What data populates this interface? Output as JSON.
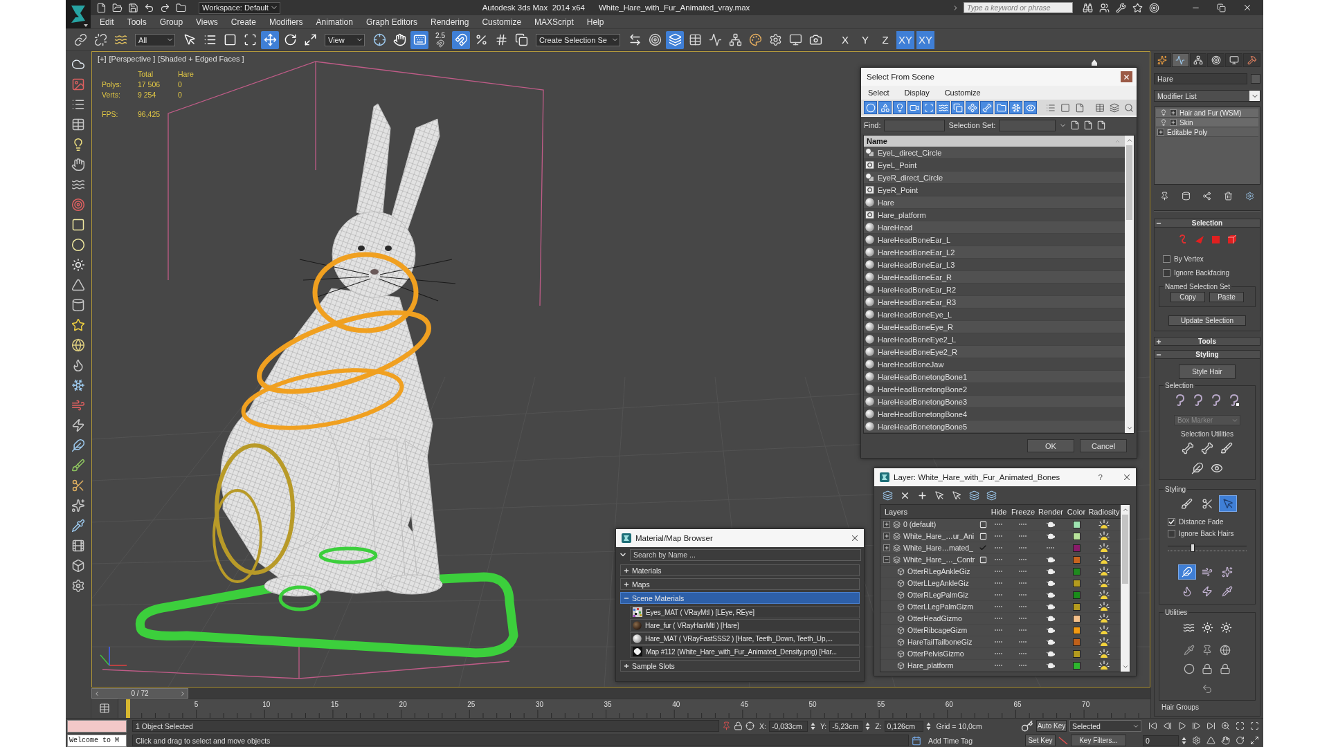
{
  "window": {
    "app_title": "Autodesk 3ds Max  2014 x64",
    "file_title": "White_Hare_with_Fur_Animated_vray.max",
    "workspace": "Workspace: Default",
    "search": {
      "placeholder": "Type a keyword or phrase"
    }
  },
  "menu": [
    "Edit",
    "Tools",
    "Group",
    "Views",
    "Create",
    "Modifiers",
    "Animation",
    "Graph Editors",
    "Rendering",
    "Customize",
    "MAXScript",
    "Help"
  ],
  "toolbar": {
    "items": [
      {
        "kind": "button",
        "selected": false
      },
      {
        "kind": "button",
        "selected": false
      },
      {
        "kind": "button",
        "selected": false
      },
      {
        "kind": "dropdown",
        "value": "All"
      },
      {
        "kind": "button",
        "selected": false
      },
      {
        "kind": "button",
        "selected": false
      },
      {
        "kind": "button",
        "selected": false
      },
      {
        "kind": "button",
        "selected": false
      },
      {
        "kind": "button",
        "selected": true
      },
      {
        "kind": "button",
        "selected": false
      },
      {
        "kind": "button",
        "selected": false
      },
      {
        "kind": "dropdown",
        "value": "View"
      },
      {
        "kind": "button",
        "selected": false
      },
      {
        "kind": "button",
        "selected": false
      },
      {
        "kind": "button",
        "selected": true
      },
      {
        "kind": "snap",
        "label": "2.5",
        "selected": false
      },
      {
        "kind": "button",
        "selected": true
      },
      {
        "kind": "button",
        "selected": false
      },
      {
        "kind": "button",
        "selected": false
      },
      {
        "kind": "button",
        "selected": false
      },
      {
        "kind": "dropdown",
        "value": "Create Selection Se"
      },
      {
        "kind": "button",
        "selected": false
      },
      {
        "kind": "button",
        "selected": false
      },
      {
        "kind": "button",
        "selected": true
      },
      {
        "kind": "button",
        "selected": false
      },
      {
        "kind": "button",
        "selected": false
      },
      {
        "kind": "button",
        "selected": false
      },
      {
        "kind": "button",
        "selected": false
      },
      {
        "kind": "button",
        "selected": false
      },
      {
        "kind": "button",
        "selected": false
      },
      {
        "kind": "button",
        "selected": false
      },
      {
        "kind": "axis",
        "label": "X",
        "selected": false
      },
      {
        "kind": "axis",
        "label": "Y",
        "selected": false
      },
      {
        "kind": "axis",
        "label": "Z",
        "selected": false
      },
      {
        "kind": "axis",
        "label": "XY",
        "selected": true
      },
      {
        "kind": "axis",
        "label": "XY",
        "selected": true
      }
    ]
  },
  "viewport": {
    "labels": [
      "[+]",
      "[Perspective ]",
      "[Shaded + Edged Faces ]"
    ],
    "stats": {
      "headers": [
        "Total",
        "Hare"
      ],
      "rows": [
        {
          "label": "Polys:",
          "values": [
            "17 506",
            "0"
          ]
        },
        {
          "label": "Verts:",
          "values": [
            "9 254",
            "0"
          ]
        }
      ],
      "fps_label": "FPS:",
      "fps": "96,425"
    }
  },
  "select_dialog": {
    "title": "Select From Scene",
    "menu": [
      "Select",
      "Display",
      "Customize"
    ],
    "filters": [
      {
        "selected": true
      },
      {
        "selected": true
      },
      {
        "selected": true
      },
      {
        "selected": true
      },
      {
        "selected": true
      },
      {
        "selected": true
      },
      {
        "selected": true
      },
      {
        "selected": true
      },
      {
        "selected": true
      },
      {
        "selected": true
      },
      {
        "selected": true
      },
      {
        "selected": true
      },
      {
        "selected": false
      },
      {
        "selected": false
      },
      {
        "selected": false
      },
      {
        "selected": false
      },
      {
        "selected": false
      },
      {
        "selected": false
      }
    ],
    "find_label": "Find:",
    "selection_set_label": "Selection Set:",
    "column": "Name",
    "rows": [
      {
        "name": "EyeL_direct_Circle",
        "kind": "shape"
      },
      {
        "name": "EyeL_Point",
        "kind": "helper"
      },
      {
        "name": "EyeR_direct_Circle",
        "kind": "shape"
      },
      {
        "name": "EyeR_Point",
        "kind": "helper"
      },
      {
        "name": "Hare",
        "kind": "geometry"
      },
      {
        "name": "Hare_platform",
        "kind": "helper"
      },
      {
        "name": "HareHead",
        "kind": "geometry"
      },
      {
        "name": "HareHeadBoneEar_L",
        "kind": "geometry"
      },
      {
        "name": "HareHeadBoneEar_L2",
        "kind": "geometry"
      },
      {
        "name": "HareHeadBoneEar_L3",
        "kind": "geometry"
      },
      {
        "name": "HareHeadBoneEar_R",
        "kind": "geometry"
      },
      {
        "name": "HareHeadBoneEar_R2",
        "kind": "geometry"
      },
      {
        "name": "HareHeadBoneEar_R3",
        "kind": "geometry"
      },
      {
        "name": "HareHeadBoneEye_L",
        "kind": "geometry"
      },
      {
        "name": "HareHeadBoneEye_R",
        "kind": "geometry"
      },
      {
        "name": "HareHeadBoneEye2_L",
        "kind": "geometry"
      },
      {
        "name": "HareHeadBoneEye2_R",
        "kind": "geometry"
      },
      {
        "name": "HareHeadBoneJaw",
        "kind": "geometry"
      },
      {
        "name": "HareHeadBonetongBone1",
        "kind": "geometry"
      },
      {
        "name": "HareHeadBonetongBone2",
        "kind": "geometry"
      },
      {
        "name": "HareHeadBonetongBone3",
        "kind": "geometry"
      },
      {
        "name": "HareHeadBonetongBone4",
        "kind": "geometry"
      },
      {
        "name": "HareHeadBonetongBone5",
        "kind": "geometry"
      }
    ],
    "buttons": [
      "OK",
      "Cancel"
    ]
  },
  "layer_dialog": {
    "title": "Layer: White_Hare_with_Fur_Animated_Bones",
    "help": "?",
    "columns": [
      "Layers",
      "Hide",
      "Freeze",
      "Render",
      "Color",
      "Radiosity"
    ],
    "layers": [
      {
        "name": "0 (default)",
        "expanded": false,
        "current": false,
        "hidden": false,
        "frozen": false,
        "render": true,
        "color": "#9ee3b0"
      },
      {
        "name": "White_Hare_…ur_Ani",
        "expanded": false,
        "current": false,
        "hidden": false,
        "frozen": false,
        "render": true,
        "color": "#b7e39a"
      },
      {
        "name": "White_Hare…mated_",
        "expanded": false,
        "current": true,
        "hidden": false,
        "frozen": false,
        "render": false,
        "color": "#8a1a6a"
      },
      {
        "name": "White_Hare_…_Contr",
        "expanded": true,
        "current": false,
        "hidden": false,
        "frozen": false,
        "render": true,
        "color": "#c8641e",
        "children": [
          {
            "name": "OtterRLegAnkleGiz",
            "hidden": false,
            "frozen": false,
            "render": true,
            "color": "#1f8a1f"
          },
          {
            "name": "OtterLLegAnkleGiz",
            "hidden": false,
            "frozen": false,
            "render": true,
            "color": "#b49b1e"
          },
          {
            "name": "OtterRLegPalmGiz",
            "hidden": false,
            "frozen": false,
            "render": true,
            "color": "#1a8c1a"
          },
          {
            "name": "OtterLLegPalmGizm",
            "hidden": false,
            "frozen": false,
            "render": true,
            "color": "#b49b1e"
          },
          {
            "name": "OtterHeadGizmo",
            "hidden": false,
            "frozen": false,
            "render": true,
            "color": "#f5c08a"
          },
          {
            "name": "OtterRibcageGizm",
            "hidden": false,
            "frozen": false,
            "render": true,
            "color": "#f29a12"
          },
          {
            "name": "HareTailTailboneGiz",
            "hidden": false,
            "frozen": false,
            "render": true,
            "color": "#c0601a"
          },
          {
            "name": "OtterPelvisGizmo",
            "hidden": false,
            "frozen": false,
            "render": true,
            "color": "#b49b1e"
          },
          {
            "name": "Hare_platform",
            "hidden": false,
            "frozen": false,
            "render": true,
            "color": "#2eb82e"
          }
        ]
      }
    ]
  },
  "material_browser": {
    "title": "Material/Map Browser",
    "search": {
      "placeholder": "Search by Name ..."
    },
    "groups": [
      {
        "label": "Materials",
        "expanded": false
      },
      {
        "label": "Maps",
        "expanded": false
      },
      {
        "label": "Scene Materials",
        "expanded": true,
        "items": [
          {
            "name": "Eyes_MAT ( VRayMtl ) [LEye, REye]",
            "kind": "noise"
          },
          {
            "name": "Hare_fur ( VRayHairMtl ) [Hare]",
            "kind": "dark"
          },
          {
            "name": "Hare_MAT ( VRayFastSSS2 ) [Hare, Teeth_Down, Teeth_Up,...",
            "kind": "light"
          },
          {
            "name": "Map #112 (White_Hare_with_Fur_Animated_Density.png) [Har...",
            "kind": "map"
          }
        ]
      },
      {
        "label": "Sample Slots",
        "expanded": false
      }
    ]
  },
  "command_panel": {
    "tabs": [
      {
        "selected": false
      },
      {
        "selected": true
      },
      {
        "selected": false
      },
      {
        "selected": false
      },
      {
        "selected": false
      },
      {
        "selected": false
      }
    ],
    "object_name": "Hare",
    "modifier_list": "Modifier List",
    "stack": [
      {
        "name": "Hair and Fur (WSM)",
        "kind": "modifier"
      },
      {
        "name": "Skin",
        "kind": "modifier"
      },
      {
        "name": "Editable Poly",
        "kind": "base"
      }
    ],
    "selection": {
      "title": "Selection",
      "expanded": true,
      "options": [
        {
          "label": "By Vertex",
          "checked": false
        },
        {
          "label": "Ignore Backfacing",
          "checked": false
        }
      ],
      "named_set": {
        "title": "Named Selection Set",
        "buttons": [
          "Copy",
          "Paste"
        ]
      },
      "update": "Update Selection"
    },
    "tools": {
      "title": "Tools",
      "expanded": false
    },
    "styling": {
      "title": "Styling",
      "expanded": true,
      "style_button": "Style Hair",
      "selection_group": {
        "title": "Selection",
        "marker": {
          "value": "Box Marker",
          "disabled": true
        },
        "utilities": "Selection Utilities"
      },
      "styling_group": {
        "title": "Styling",
        "tools": [
          {
            "selected": false
          },
          {
            "selected": false
          },
          {
            "selected": true
          }
        ],
        "options": [
          {
            "label": "Distance Fade",
            "checked": true
          },
          {
            "label": "Ignore Back Hairs",
            "checked": false
          }
        ],
        "slider": {
          "level": 0.32
        },
        "brushes": [
          {
            "selected": true
          },
          {
            "selected": false
          },
          {
            "selected": false
          },
          {
            "selected": false
          },
          {
            "selected": false
          },
          {
            "selected": false
          }
        ]
      },
      "utilities_group": {
        "title": "Utilities"
      },
      "hair_groups": "Hair Groups"
    }
  },
  "timeline": {
    "slider": "0 / 72",
    "ticks": [
      "5",
      "10",
      "15",
      "20",
      "25",
      "30",
      "35",
      "40",
      "45",
      "50",
      "55",
      "60",
      "65",
      "70"
    ]
  },
  "status_bar": {
    "listener_output": "Welcome to M",
    "selection": "1 Object Selected",
    "prompt": "Click and drag to select and move objects",
    "coords": [
      {
        "axis": "X:",
        "value": "-0,033cm"
      },
      {
        "axis": "Y:",
        "value": "-5,23cm"
      },
      {
        "axis": "Z:",
        "value": "0,126cm"
      }
    ],
    "grid": "Grid = 10,0cm",
    "time_tag": "Add Time Tag",
    "auto_key": "Auto Key",
    "key_mode": "Selected",
    "set_key": "Set Key",
    "key_filters": "Key Filters...",
    "frame": "0"
  }
}
